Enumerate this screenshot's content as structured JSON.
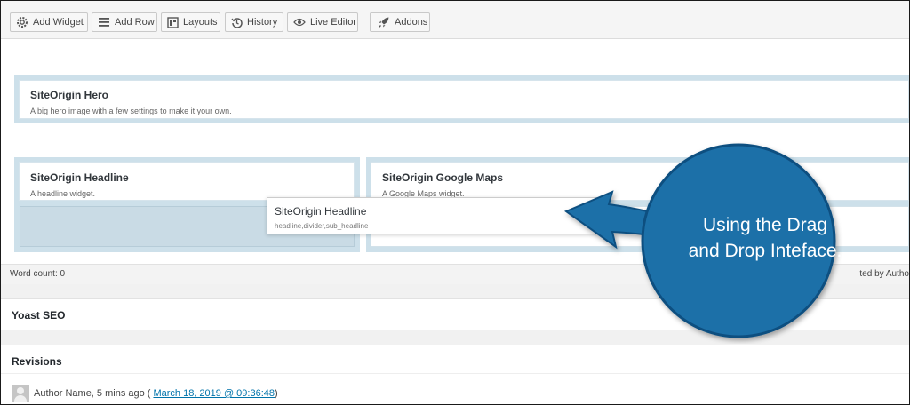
{
  "toolbar": {
    "buttons": [
      {
        "label": "Add Widget",
        "icon": "gear-icon"
      },
      {
        "label": "Add Row",
        "icon": "list-icon"
      },
      {
        "label": "Layouts",
        "icon": "layout-icon"
      },
      {
        "label": "History",
        "icon": "history-icon"
      },
      {
        "label": "Live Editor",
        "icon": "eye-icon"
      },
      {
        "label": "Addons",
        "icon": "rocket-icon"
      }
    ]
  },
  "builder": {
    "hero": {
      "title": "SiteOrigin Hero",
      "description": "A big hero image with a few settings to make it your own."
    },
    "headline": {
      "title": "SiteOrigin Headline",
      "description": "A headline widget."
    },
    "maps": {
      "title": "SiteOrigin Google Maps",
      "description": "A Google Maps widget."
    },
    "dragging": {
      "title": "SiteOrigin Headline",
      "meta": "headline,divider,sub_headline"
    }
  },
  "editor_footer": {
    "word_count": "Word count: 0",
    "last_edited": "ted by Autho"
  },
  "metaboxes": {
    "yoast": "Yoast SEO",
    "revisions": "Revisions"
  },
  "revision_entry": {
    "author": "Author Name, 5 mins ago (",
    "link": "March 18, 2019 @ 09:36:48",
    "close": ")"
  },
  "callout": {
    "line1": "Using the Drag",
    "line2": "and Drop Inteface.",
    "color": "#1f6fa8"
  }
}
